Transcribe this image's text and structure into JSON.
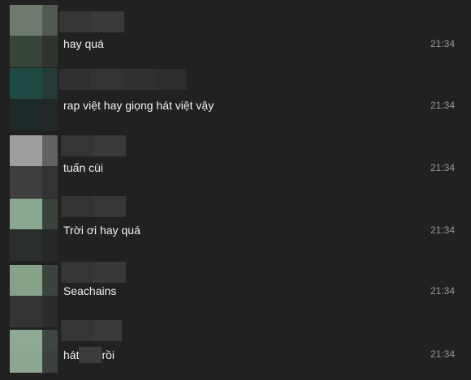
{
  "messages": [
    {
      "text": "hay quá",
      "time": "21:34",
      "avatar_colors": [
        "#6d7a6d",
        "#515751",
        "#38463a",
        "#2f342f"
      ],
      "name_colors": [
        "#353535",
        "#3a3a3a"
      ]
    },
    {
      "text": "rap việt hay giọng hát việt vậy",
      "time": "21:34",
      "avatar_colors": [
        "#1f4a43",
        "#243a37",
        "#1c2b29",
        "#222826"
      ],
      "name_colors": [
        "#2f2f2f",
        "#333333",
        "#303030",
        "#2d2d2d"
      ]
    },
    {
      "text": "tuấn cùi",
      "time": "21:34",
      "avatar_colors": [
        "#9e9e9e",
        "#626262",
        "#3f3f3f",
        "#333333"
      ],
      "name_colors": [
        "#353535",
        "#3a3a3a"
      ]
    },
    {
      "text": "Trời ơi hay quá",
      "time": "21:34",
      "avatar_colors": [
        "#88a88f",
        "#3b423c",
        "#2a2f2b",
        "#262826"
      ],
      "name_colors": [
        "#333333",
        "#373737"
      ]
    },
    {
      "text": "Seachains",
      "time": "21:34",
      "avatar_colors": [
        "#86a289",
        "#3d433e",
        "#333533",
        "#2b2c2b"
      ],
      "name_colors": [
        "#353535",
        "#383838"
      ]
    },
    {
      "text_before": "hát",
      "text_after": "rồi",
      "time": "21:34",
      "avatar_colors": [
        "#8eaa92",
        "#3f4540",
        "#8ba78f",
        "#3b403c"
      ],
      "name_colors": [
        "#353535",
        "#3a3a3a"
      ]
    }
  ]
}
